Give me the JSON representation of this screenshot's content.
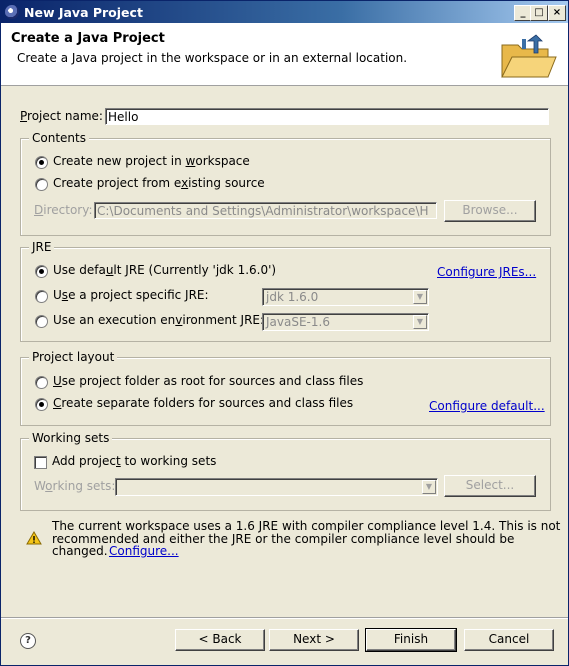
{
  "window": {
    "title": "New Java Project",
    "minimize": "_",
    "maximize": "□",
    "close": "×"
  },
  "banner": {
    "title": "Create a Java Project",
    "description": "Create a Java project in the workspace or in an external location."
  },
  "project_name": {
    "label_pre": "",
    "label_u": "P",
    "label_post": "roject name:",
    "value": "Hello"
  },
  "contents": {
    "title": "Contents",
    "opt_new_pre": "Create new project in ",
    "opt_new_u": "w",
    "opt_new_post": "orkspace",
    "opt_existing_pre": "Create project from e",
    "opt_existing_u": "x",
    "opt_existing_post": "isting source",
    "directory_label_u": "D",
    "directory_label_post": "irectory:",
    "directory_value": "C:\\Documents and Settings\\Administrator\\workspace\\H",
    "browse": "Browse..."
  },
  "jre": {
    "title": "JRE",
    "opt_default_pre": "Use defa",
    "opt_default_u": "u",
    "opt_default_post": "lt JRE (Currently 'jdk 1.6.0')",
    "configure_link": "Configure JREs...",
    "opt_specific_pre": "U",
    "opt_specific_u": "s",
    "opt_specific_post": "e a project specific JRE:",
    "specific_value": "jdk 1.6.0",
    "opt_env_pre": "Use an execution en",
    "opt_env_u": "v",
    "opt_env_post": "ironment JRE:",
    "env_value": "JavaSE-1.6"
  },
  "layout": {
    "title": "Project layout",
    "opt_root_pre": "",
    "opt_root_u": "U",
    "opt_root_post": "se project folder as root for sources and class files",
    "opt_separate_pre": "",
    "opt_separate_u": "C",
    "opt_separate_post": "reate separate folders for sources and class files",
    "configure_link": "Configure default..."
  },
  "working_sets": {
    "title": "Working sets",
    "add_pre": "Add projec",
    "add_u": "t",
    "add_post": " to working sets",
    "label_pre": "W",
    "label_u": "o",
    "label_post": "rking sets:",
    "select": "Select..."
  },
  "warning": {
    "line1": "The current workspace uses a 1.6 JRE with compiler compliance level 1.4. This is not",
    "line2": "recommended and either the JRE or the compiler compliance level should be",
    "line3": "changed.",
    "link": "Configure..."
  },
  "buttons": {
    "back": "< Back",
    "next": "Next >",
    "finish": "Finish",
    "cancel": "Cancel"
  },
  "icons": {
    "help": "?",
    "warning": "warning-icon",
    "banner": "java-folder-icon"
  }
}
